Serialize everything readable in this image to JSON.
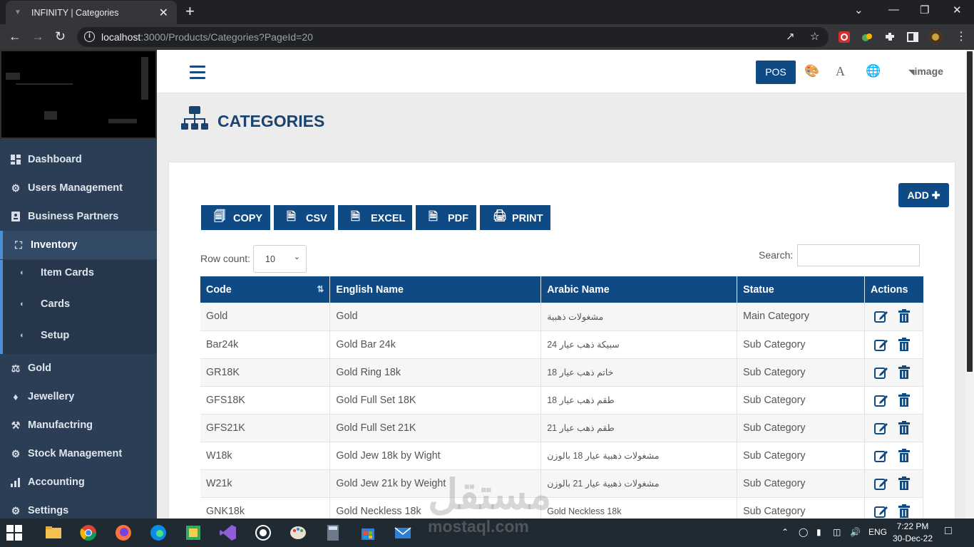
{
  "browser": {
    "tab_title": "INFINITY | Categories",
    "url_host": "localhost",
    "url_rest": ":3000/Products/Categories?PageId=20"
  },
  "sidebar": {
    "items_top": [
      {
        "label": "Dashboard",
        "icon": "dashboard-icon"
      },
      {
        "label": "Users Management",
        "icon": "gear-icon"
      },
      {
        "label": "Business Partners",
        "icon": "id-card-icon"
      }
    ],
    "active": {
      "label": "Inventory",
      "icon": "inventory-icon"
    },
    "sub": [
      {
        "label": "Item Cards"
      },
      {
        "label": "Cards"
      },
      {
        "label": "Setup"
      }
    ],
    "items_bottom": [
      {
        "label": "Gold",
        "icon": "gold-icon"
      },
      {
        "label": "Jewellery",
        "icon": "jewellery-icon"
      },
      {
        "label": "Manufactring",
        "icon": "manufacturing-icon"
      },
      {
        "label": "Stock Management",
        "icon": "stock-icon"
      },
      {
        "label": "Accounting",
        "icon": "chart-icon"
      },
      {
        "label": "Settings",
        "icon": "gear-icon"
      }
    ]
  },
  "header": {
    "pos_label": "POS",
    "image_alt": "image"
  },
  "page": {
    "title": "CATEGORIES",
    "add_label": "ADD",
    "export_buttons": [
      "COPY",
      "CSV",
      "EXCEL",
      "PDF",
      "PRINT"
    ],
    "row_count_label": "Row count:",
    "row_count_value": "10",
    "search_label": "Search:"
  },
  "table": {
    "headers": [
      "Code",
      "English Name",
      "Arabic Name",
      "Statue",
      "Actions"
    ],
    "rows": [
      [
        "Gold",
        "Gold",
        "مشغولات ذهبية",
        "Main Category"
      ],
      [
        "Bar24k",
        "Gold Bar 24k",
        "سبيكة ذهب عيار 24",
        "Sub Category"
      ],
      [
        "GR18K",
        "Gold Ring 18k",
        "خاتم ذهب عيار 18",
        "Sub Category"
      ],
      [
        "GFS18K",
        "Gold Full Set 18K",
        "طقم ذهب عيار 18",
        "Sub Category"
      ],
      [
        "GFS21K",
        "Gold Full Set 21K",
        "طقم ذهب عيار 21",
        "Sub Category"
      ],
      [
        "W18k",
        "Gold Jew 18k by Wight",
        "مشغولات ذهبية عيار 18 بالوزن",
        "Sub Category"
      ],
      [
        "W21k",
        "Gold Jew 21k by Weight",
        "مشغولات ذهبية عيار 21 بالوزن",
        "Sub Category"
      ],
      [
        "GNK18k",
        "Gold Neckless 18k",
        "Gold Neckless 18k",
        "Sub Category"
      ]
    ]
  },
  "watermark": {
    "arabic": "مستقل",
    "latin": "mostaql.com"
  },
  "taskbar": {
    "lang": "ENG",
    "time": "7:22 PM",
    "date": "30-Dec-22"
  }
}
